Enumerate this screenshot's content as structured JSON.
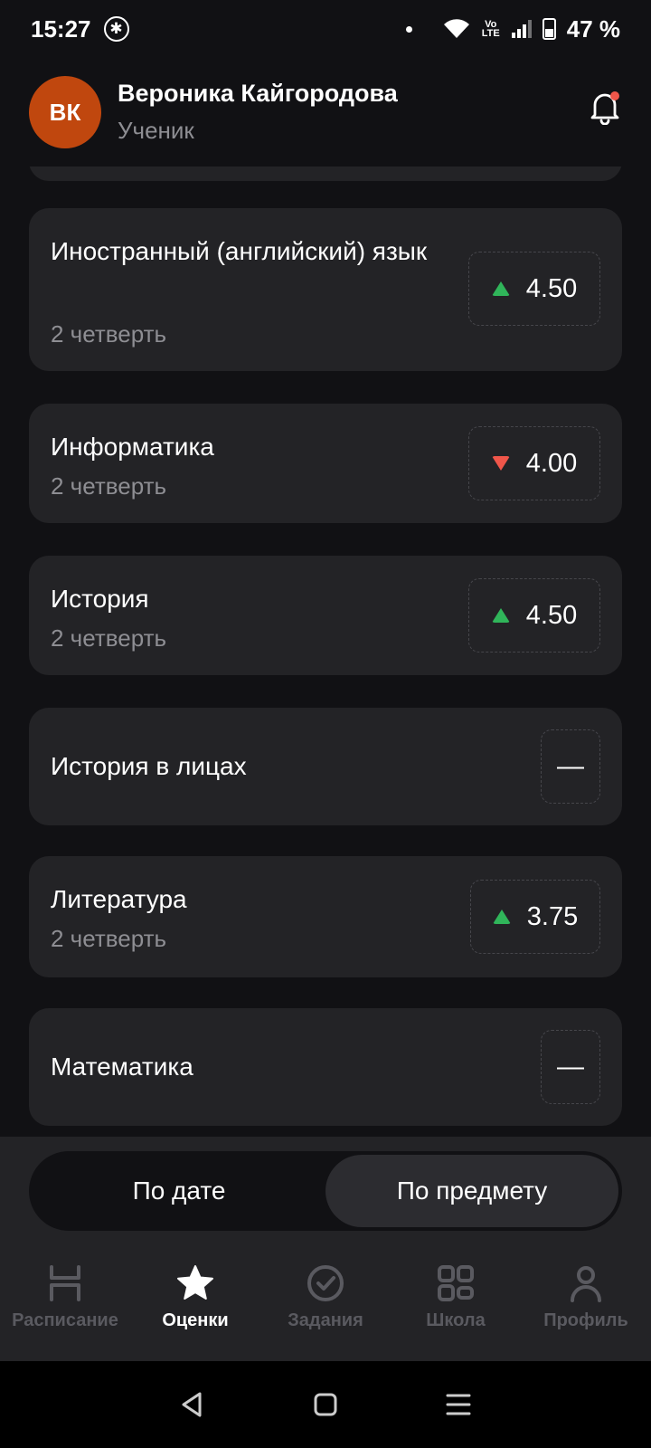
{
  "status_bar": {
    "time": "15:27",
    "battery": "47 %",
    "network_label": "Vo LTE"
  },
  "header": {
    "avatar_initials": "ВК",
    "user_name": "Вероника Кайгородова",
    "user_role": "Ученик"
  },
  "colors": {
    "up": "#30b55a",
    "down": "#f0564a",
    "avatar": "#c0470e",
    "card": "#232326",
    "background": "#111114"
  },
  "subjects": [
    {
      "title": "Иностранный (английский) язык",
      "period": "2 четверть",
      "grade": "4.50",
      "trend": "up"
    },
    {
      "title": "Информатика",
      "period": "2 четверть",
      "grade": "4.00",
      "trend": "down"
    },
    {
      "title": "История",
      "period": "2 четверть",
      "grade": "4.50",
      "trend": "up"
    },
    {
      "title": "История в лицах",
      "period": "",
      "grade": "—",
      "trend": "none"
    },
    {
      "title": "Литература",
      "period": "2 четверть",
      "grade": "3.75",
      "trend": "up"
    },
    {
      "title": "Математика",
      "period": "",
      "grade": "—",
      "trend": "none"
    }
  ],
  "sort_toggle": {
    "by_date": "По дате",
    "by_subject": "По предмету",
    "selected": "by_subject"
  },
  "bottom_nav": {
    "items": [
      {
        "label": "Расписание",
        "icon": "schedule-icon"
      },
      {
        "label": "Оценки",
        "icon": "star-icon",
        "active": true
      },
      {
        "label": "Задания",
        "icon": "check-circle-icon"
      },
      {
        "label": "Школа",
        "icon": "grid-icon"
      },
      {
        "label": "Профиль",
        "icon": "person-icon"
      }
    ]
  }
}
